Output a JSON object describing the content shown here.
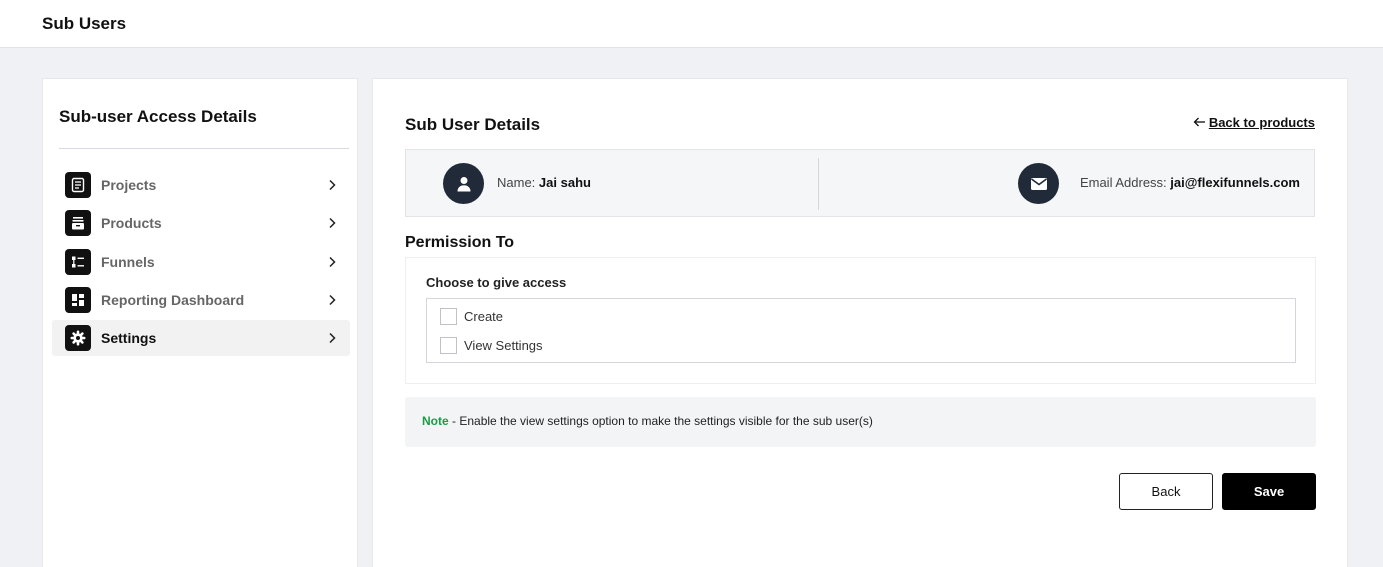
{
  "header": {
    "title": "Sub Users"
  },
  "sidebar": {
    "heading": "Sub-user Access Details",
    "items": [
      {
        "label": "Projects",
        "icon": "projects-icon"
      },
      {
        "label": "Products",
        "icon": "products-icon"
      },
      {
        "label": "Funnels",
        "icon": "funnels-icon"
      },
      {
        "label": "Reporting Dashboard",
        "icon": "dashboard-icon"
      },
      {
        "label": "Settings",
        "icon": "gear-icon",
        "active": true
      }
    ]
  },
  "main": {
    "title": "Sub User Details",
    "back_link": "Back to products",
    "name_label": "Name:",
    "name_value": "Jai sahu",
    "email_label": "Email Address:",
    "email_value": "jai@flexifunnels.com",
    "permission_title": "Permission To",
    "choose_label": "Choose to give access",
    "options": [
      {
        "label": "Create",
        "checked": false
      },
      {
        "label": "View Settings",
        "checked": false
      }
    ],
    "note_tag": "Note",
    "note_text": " - Enable the view settings option to make the settings visible for the sub user(s)",
    "back_button": "Back",
    "save_button": "Save"
  },
  "colors": {
    "accent": "#000000",
    "note_green": "#1a9c46",
    "avatar_bg": "#212a38"
  }
}
